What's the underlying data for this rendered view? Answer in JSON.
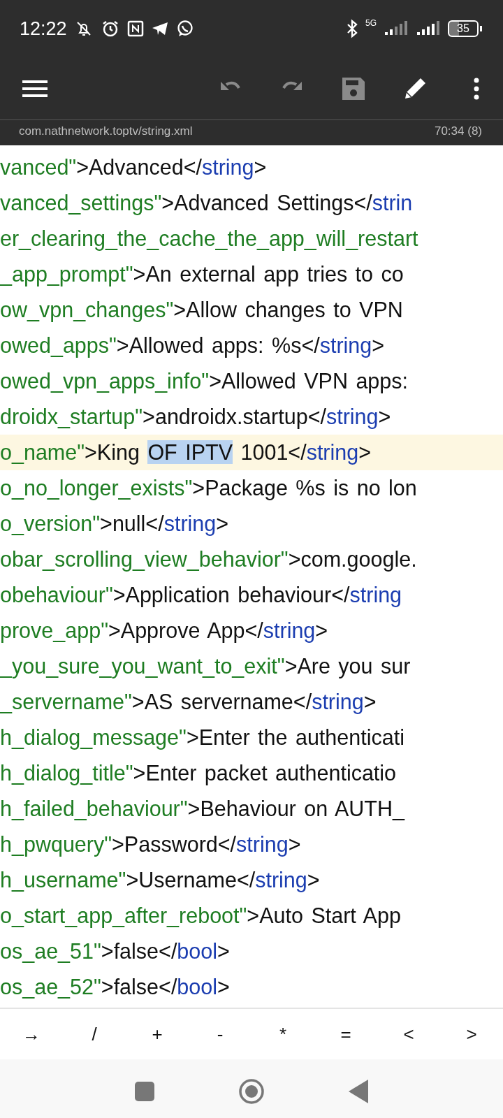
{
  "status_bar": {
    "time": "12:22",
    "network": "5G",
    "battery": "35"
  },
  "toolbar_actions": [
    {
      "kind": "undo",
      "disabled": true
    },
    {
      "kind": "redo",
      "disabled": true
    },
    {
      "kind": "save",
      "disabled": true
    },
    {
      "kind": "edit",
      "disabled": false
    },
    {
      "kind": "more",
      "disabled": false
    }
  ],
  "path_bar": {
    "file": "com.nathnetwork.toptv/string.xml",
    "position": "70:34 (8)"
  },
  "code_lines": [
    {
      "current": false,
      "tokens": [
        {
          "kind": "attr",
          "text": "vanced\""
        },
        {
          "kind": "text",
          "text": ">Advanced</"
        },
        {
          "kind": "tag",
          "text": "string"
        },
        {
          "kind": "text",
          "text": ">"
        }
      ]
    },
    {
      "current": false,
      "tokens": [
        {
          "kind": "attr",
          "text": "vanced_settings\""
        },
        {
          "kind": "text",
          "text": ">Advanced Settings</"
        },
        {
          "kind": "tag",
          "text": "strin"
        }
      ]
    },
    {
      "current": false,
      "tokens": [
        {
          "kind": "attr",
          "text": "er_clearing_the_cache_the_app_will_restart"
        }
      ]
    },
    {
      "current": false,
      "tokens": [
        {
          "kind": "attr",
          "text": "_app_prompt\""
        },
        {
          "kind": "text",
          "text": ">An external app tries to co"
        }
      ]
    },
    {
      "current": false,
      "tokens": [
        {
          "kind": "attr",
          "text": "ow_vpn_changes\""
        },
        {
          "kind": "text",
          "text": ">Allow changes to VPN"
        }
      ]
    },
    {
      "current": false,
      "tokens": [
        {
          "kind": "attr",
          "text": "owed_apps\""
        },
        {
          "kind": "text",
          "text": ">Allowed apps: %s</"
        },
        {
          "kind": "tag",
          "text": "string"
        },
        {
          "kind": "text",
          "text": ">"
        }
      ]
    },
    {
      "current": false,
      "tokens": [
        {
          "kind": "attr",
          "text": "owed_vpn_apps_info\""
        },
        {
          "kind": "text",
          "text": ">Allowed VPN apps:"
        }
      ]
    },
    {
      "current": false,
      "tokens": [
        {
          "kind": "attr",
          "text": "droidx_startup\""
        },
        {
          "kind": "text",
          "text": ">androidx.startup</"
        },
        {
          "kind": "tag",
          "text": "string"
        },
        {
          "kind": "text",
          "text": ">"
        }
      ]
    },
    {
      "current": true,
      "tokens": [
        {
          "kind": "attr",
          "text": "o_name\""
        },
        {
          "kind": "text",
          "text": ">King "
        },
        {
          "kind": "selection",
          "text": "OF IPTV"
        },
        {
          "kind": "text",
          "text": " 1001</"
        },
        {
          "kind": "tag",
          "text": "string"
        },
        {
          "kind": "text",
          "text": ">"
        }
      ]
    },
    {
      "current": false,
      "tokens": [
        {
          "kind": "attr",
          "text": "o_no_longer_exists\""
        },
        {
          "kind": "text",
          "text": ">Package %s is no lon"
        }
      ]
    },
    {
      "current": false,
      "tokens": [
        {
          "kind": "attr",
          "text": "o_version\""
        },
        {
          "kind": "text",
          "text": ">null</"
        },
        {
          "kind": "tag",
          "text": "string"
        },
        {
          "kind": "text",
          "text": ">"
        }
      ]
    },
    {
      "current": false,
      "tokens": [
        {
          "kind": "attr",
          "text": "obar_scrolling_view_behavior\""
        },
        {
          "kind": "text",
          "text": ">com.google."
        }
      ]
    },
    {
      "current": false,
      "tokens": [
        {
          "kind": "attr",
          "text": "obehaviour\""
        },
        {
          "kind": "text",
          "text": ">Application behaviour</"
        },
        {
          "kind": "tag",
          "text": "string"
        }
      ]
    },
    {
      "current": false,
      "tokens": [
        {
          "kind": "attr",
          "text": "prove_app\""
        },
        {
          "kind": "text",
          "text": ">Approve App</"
        },
        {
          "kind": "tag",
          "text": "string"
        },
        {
          "kind": "text",
          "text": ">"
        }
      ]
    },
    {
      "current": false,
      "tokens": [
        {
          "kind": "attr",
          "text": "_you_sure_you_want_to_exit\""
        },
        {
          "kind": "text",
          "text": ">Are you sur"
        }
      ]
    },
    {
      "current": false,
      "tokens": [
        {
          "kind": "attr",
          "text": "_servername\""
        },
        {
          "kind": "text",
          "text": ">AS servername</"
        },
        {
          "kind": "tag",
          "text": "string"
        },
        {
          "kind": "text",
          "text": ">"
        }
      ]
    },
    {
      "current": false,
      "tokens": [
        {
          "kind": "attr",
          "text": "h_dialog_message\""
        },
        {
          "kind": "text",
          "text": ">Enter the authenticati"
        }
      ]
    },
    {
      "current": false,
      "tokens": [
        {
          "kind": "attr",
          "text": "h_dialog_title\""
        },
        {
          "kind": "text",
          "text": ">Enter packet authenticatio"
        }
      ]
    },
    {
      "current": false,
      "tokens": [
        {
          "kind": "attr",
          "text": "h_failed_behaviour\""
        },
        {
          "kind": "text",
          "text": ">Behaviour on AUTH_"
        }
      ]
    },
    {
      "current": false,
      "tokens": [
        {
          "kind": "attr",
          "text": "h_pwquery\""
        },
        {
          "kind": "text",
          "text": ">Password</"
        },
        {
          "kind": "tag",
          "text": "string"
        },
        {
          "kind": "text",
          "text": ">"
        }
      ]
    },
    {
      "current": false,
      "tokens": [
        {
          "kind": "attr",
          "text": "h_username\""
        },
        {
          "kind": "text",
          "text": ">Username</"
        },
        {
          "kind": "tag",
          "text": "string"
        },
        {
          "kind": "text",
          "text": ">"
        }
      ]
    },
    {
      "current": false,
      "tokens": [
        {
          "kind": "attr",
          "text": "o_start_app_after_reboot\""
        },
        {
          "kind": "text",
          "text": ">Auto Start App"
        }
      ]
    },
    {
      "current": false,
      "tokens": [
        {
          "kind": "attr",
          "text": "os_ae_51\""
        },
        {
          "kind": "text",
          "text": ">false</"
        },
        {
          "kind": "tag",
          "text": "bool"
        },
        {
          "kind": "text",
          "text": ">"
        }
      ]
    },
    {
      "current": false,
      "tokens": [
        {
          "kind": "attr",
          "text": "os_ae_52\""
        },
        {
          "kind": "text",
          "text": ">false</"
        },
        {
          "kind": "tag",
          "text": "bool"
        },
        {
          "kind": "text",
          "text": ">"
        }
      ]
    }
  ],
  "symbol_keys": [
    "→",
    "/",
    "+",
    "-",
    "*",
    "=",
    "<",
    ">"
  ]
}
